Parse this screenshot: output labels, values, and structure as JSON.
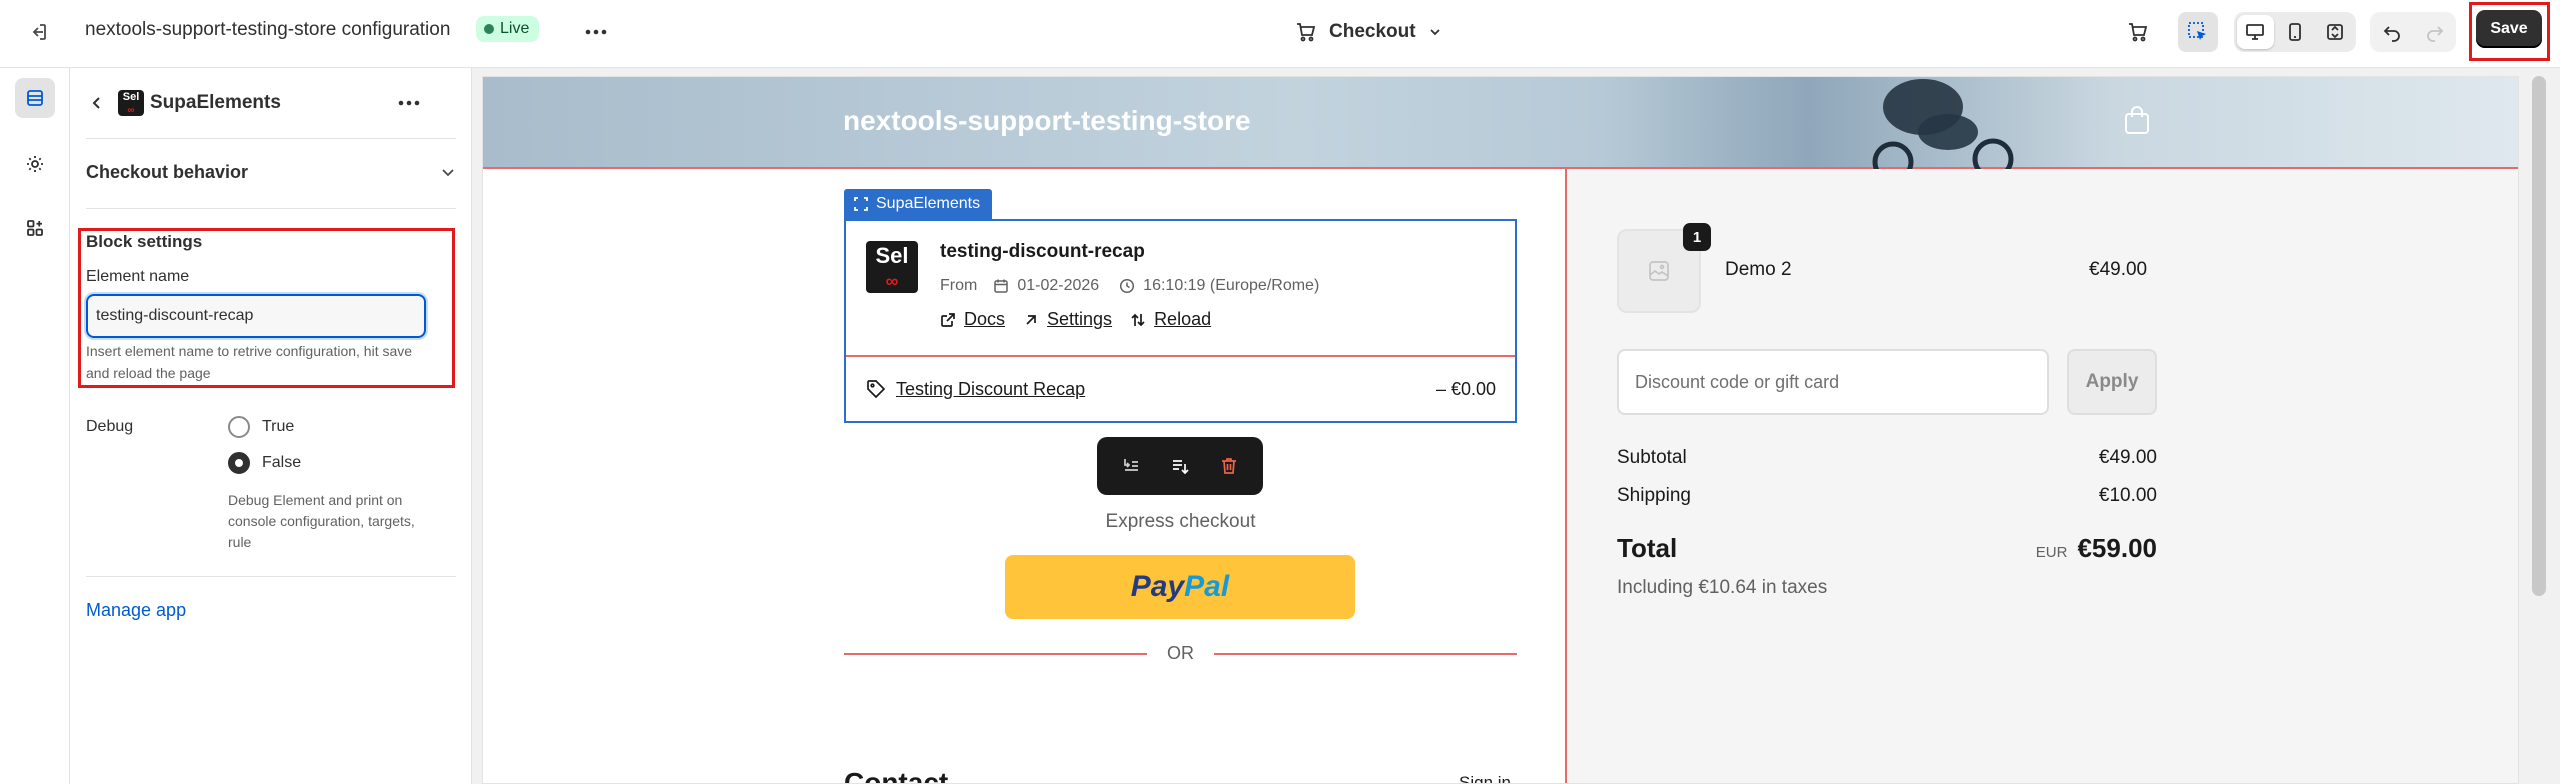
{
  "topbar": {
    "store_title": "nextools-support-testing-store configuration",
    "status_badge": "Live",
    "page_selector": "Checkout",
    "save_label": "Save"
  },
  "panel": {
    "app_name": "SupaElements",
    "app_logo_text": "Sel",
    "section_checkout_behavior": "Checkout behavior",
    "block_settings_title": "Block settings",
    "element_name_label": "Element name",
    "element_name_value": "testing-discount-recap",
    "element_name_help": "Insert element name to retrive configuration, hit save and reload the page",
    "debug_label": "Debug",
    "debug_options": [
      "True",
      "False"
    ],
    "debug_selected": "False",
    "debug_help": "Debug Element and print on console configuration, targets, rule",
    "manage_app": "Manage app"
  },
  "preview": {
    "store_name": "nextools-support-testing-store",
    "selection_tag": "SupaElements",
    "element": {
      "logo_text": "Sel",
      "title": "testing-discount-recap",
      "from_label": "From",
      "date": "01-02-2026",
      "time": "16:10:19 (Europe/Rome)",
      "links": [
        "Docs",
        "Settings",
        "Reload"
      ],
      "discount_label": "Testing Discount Recap",
      "discount_value": "– €0.00"
    },
    "express_checkout": "Express checkout",
    "paypal_a": "Pay",
    "paypal_b": "Pal",
    "or_label": "OR",
    "contact_heading": "Contact",
    "signin": "Sign in"
  },
  "summary": {
    "product_name": "Demo 2",
    "product_qty": "1",
    "product_price": "€49.00",
    "discount_placeholder": "Discount code or gift card",
    "apply_label": "Apply",
    "subtotal_label": "Subtotal",
    "subtotal_value": "€49.00",
    "shipping_label": "Shipping",
    "shipping_value": "€10.00",
    "total_label": "Total",
    "total_currency": "EUR",
    "total_value": "€59.00",
    "taxes_note": "Including €10.64 in taxes"
  },
  "colors": {
    "accent_blue": "#2c6ecb",
    "highlight_red": "#e11b1b",
    "live_green": "#29845a",
    "paypal_yellow": "#ffc439"
  }
}
